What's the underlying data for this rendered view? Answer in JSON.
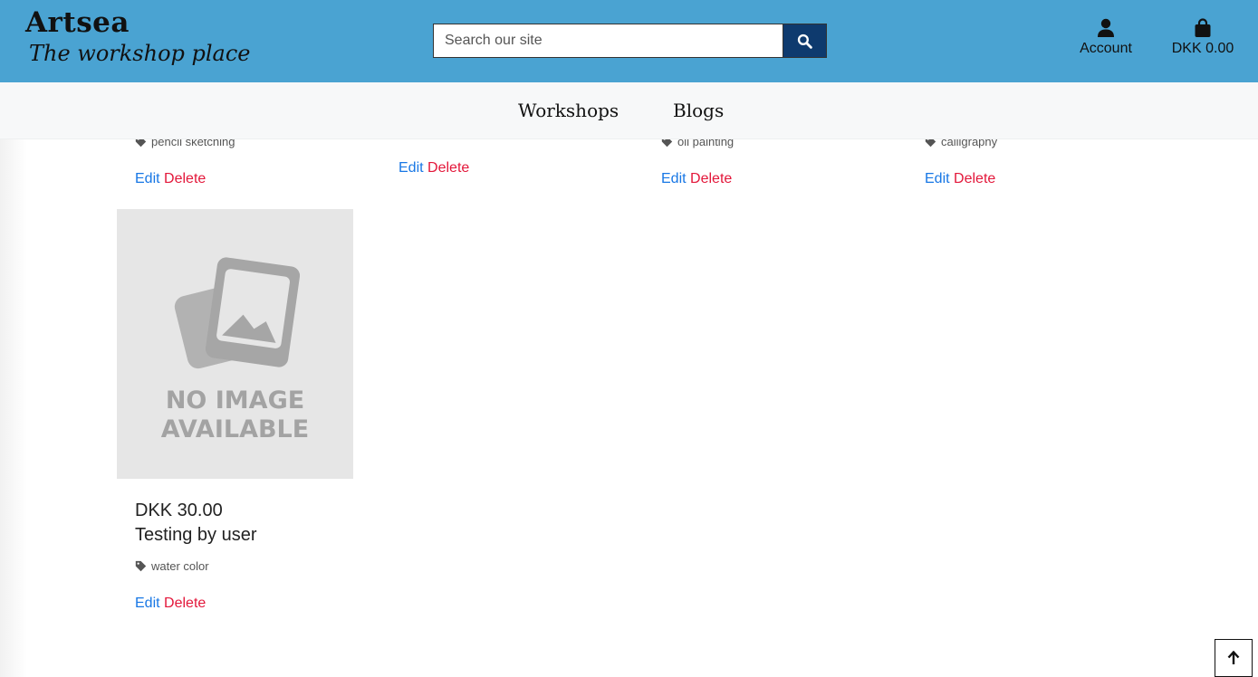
{
  "header": {
    "brand_name": "Artsea",
    "brand_tagline": "The workshop place",
    "search_placeholder": "Search our site",
    "account_label": "Account",
    "bag_label": "DKK 0.00"
  },
  "nav": {
    "items": [
      "Workshops",
      "Blogs"
    ]
  },
  "cards_top": [
    {
      "tag": "pencil sketching",
      "edit": "Edit",
      "delete": "Delete"
    },
    {
      "tag": "",
      "edit": "Edit",
      "delete": "Delete"
    },
    {
      "tag": "oil painting",
      "edit": "Edit",
      "delete": "Delete"
    },
    {
      "tag": "calligraphy",
      "edit": "Edit",
      "delete": "Delete"
    }
  ],
  "card_main": {
    "image_text_line1": "NO IMAGE",
    "image_text_line2": "AVAILABLE",
    "price": "DKK 30.00",
    "title": "Testing by user",
    "tag": "water color",
    "edit": "Edit",
    "delete": "Delete"
  },
  "colors": {
    "header_bg": "#4aa3d2",
    "search_button": "#0e3a6e",
    "edit_link": "#1877e5",
    "delete_link": "#e3173a"
  },
  "icons": [
    "search-icon",
    "user-icon",
    "shopping-bag-icon",
    "tag-icon",
    "arrow-up-icon",
    "image-placeholder-icon"
  ]
}
